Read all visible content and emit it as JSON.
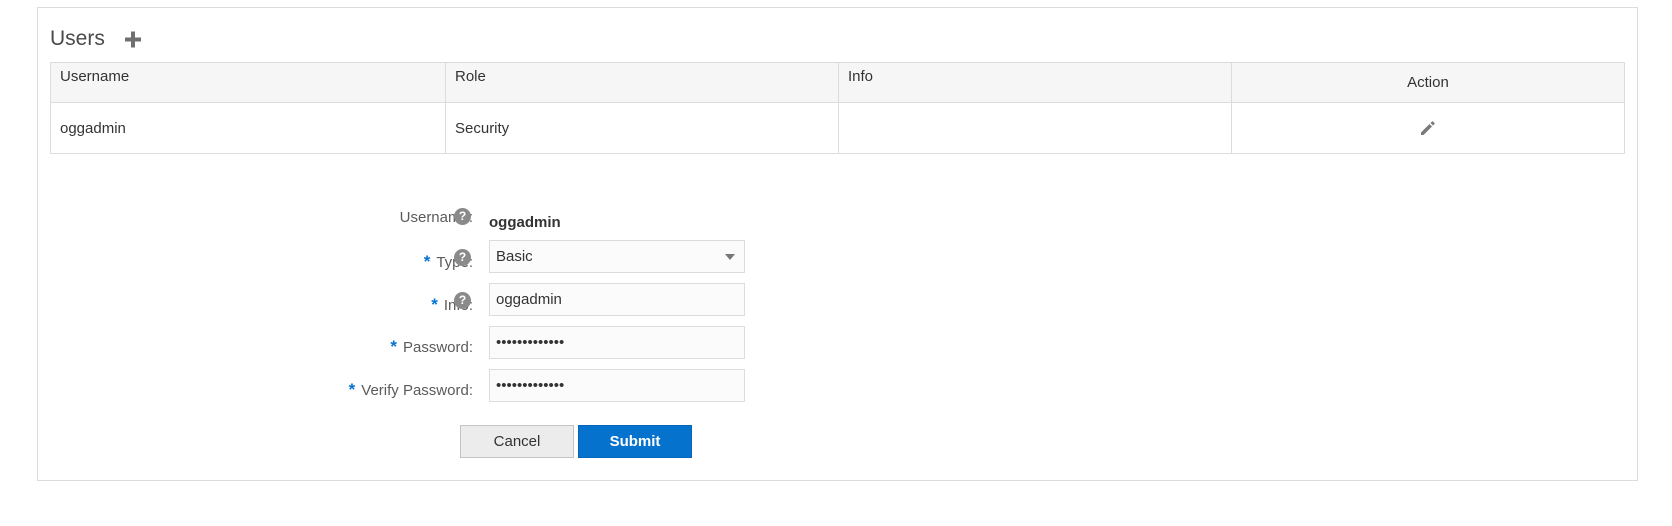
{
  "section": {
    "title": "Users",
    "add_icon": "plus-icon"
  },
  "table": {
    "columns": [
      "Username",
      "Role",
      "Info",
      "Action"
    ],
    "rows": [
      {
        "username": "oggadmin",
        "role": "Security",
        "info": "",
        "action_icon": "pencil-icon"
      }
    ]
  },
  "form": {
    "required_marker": "*",
    "help_glyph": "?",
    "username_label": "Username:",
    "username_value": "oggadmin",
    "type_label": "Type:",
    "type_value": "Basic",
    "info_label": "Info:",
    "info_value": "oggadmin",
    "password_label": "Password:",
    "password_value": "•••••••••••••",
    "verify_label": "Verify Password:",
    "verify_value": "•••••••••••••",
    "cancel_label": "Cancel",
    "submit_label": "Submit"
  },
  "colors": {
    "accent": "#0572ce",
    "border": "#dcdcdc",
    "header_bg": "#f6f6f6"
  }
}
